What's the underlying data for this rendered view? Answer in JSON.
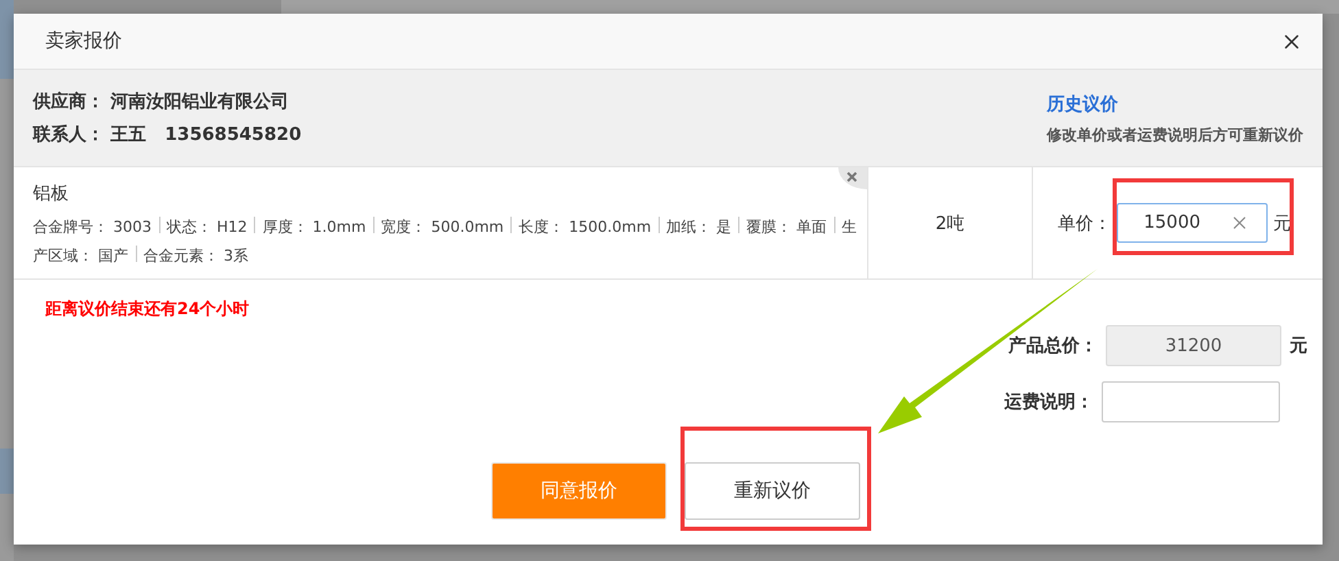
{
  "dialog": {
    "title": "卖家报价",
    "supplier": {
      "label": "供应商：",
      "value": "河南汝阳铝业有限公司"
    },
    "contact": {
      "label": "联系人：",
      "name": "王五",
      "phone": "13568545820"
    },
    "history_link": "历史议价",
    "hint": "修改单价或者运费说明后方可重新议价",
    "product": {
      "name": "铝板",
      "specs": [
        {
          "label": "合金牌号：",
          "value": "3003"
        },
        {
          "label": "状态：",
          "value": "H12"
        },
        {
          "label": "厚度：",
          "value": "1.0mm"
        },
        {
          "label": "宽度：",
          "value": "500.0mm"
        },
        {
          "label": "长度：",
          "value": "1500.0mm"
        },
        {
          "label": "加纸：",
          "value": "是"
        },
        {
          "label": "覆膜：",
          "value": "单面"
        },
        {
          "label": "生产区域：",
          "value": "国产"
        },
        {
          "label": "合金元素：",
          "value": "3系"
        }
      ],
      "quantity": "2吨",
      "unit_price_label": "单价：",
      "unit_price": "15000",
      "unit_price_unit": "元"
    },
    "countdown": "距离议价结束还有24个小时",
    "total_label": "产品总价：",
    "total": "31200",
    "total_unit": "元",
    "freight_label": "运费说明：",
    "buttons": [
      {
        "label": "同意报价",
        "kind": "primary"
      },
      {
        "label": "重新议价",
        "kind": "secondary"
      }
    ]
  }
}
